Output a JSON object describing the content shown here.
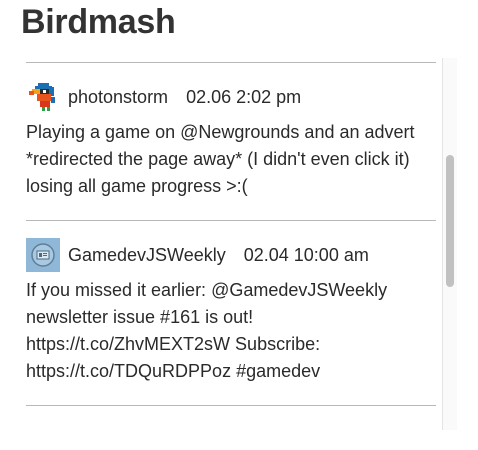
{
  "app": {
    "title": "Birdmash"
  },
  "tweets": [
    {
      "author": "photonstorm",
      "timestamp": "02.06 2:02 pm",
      "avatar_icon": "pixel-toucan-avatar",
      "text": "Playing a game on @Newgrounds and an advert *redirected the page away* (I didn't even click it) losing all game progress >:("
    },
    {
      "author": "GamedevJSWeekly",
      "timestamp": "02.04 10:00 am",
      "avatar_icon": "newsletter-avatar",
      "text": "If you missed it earlier: @GamedevJSWeekly newsletter issue #161 is out! https://t.co/ZhvMEXT2sW Subscribe: https://t.co/TDQuRDPPoz #gamedev"
    }
  ],
  "colors": {
    "divider": "#b8b8b8",
    "text": "#2a2a2a",
    "scrollbar_thumb": "#c1c1c1"
  }
}
